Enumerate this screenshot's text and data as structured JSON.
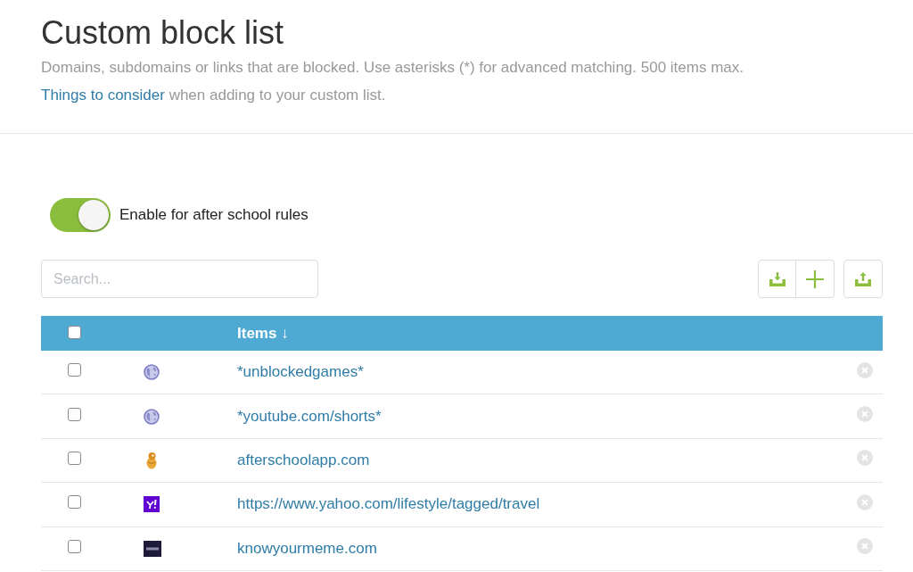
{
  "header": {
    "title": "Custom block list",
    "description": "Domains, subdomains or links that are blocked. Use asterisks (*) for advanced matching. 500 items max.",
    "note": {
      "link": "Things to consider",
      "text": "when adding to your custom list."
    }
  },
  "toggle": {
    "label": "Enable for after school rules",
    "on": true
  },
  "search": {
    "placeholder": "Search..."
  },
  "table": {
    "select_all": {
      "checked": false
    },
    "column_header": "Items ↓",
    "rows": [
      {
        "kind": "globe",
        "label": "*unblockedgames*",
        "checked": false
      },
      {
        "kind": "globe",
        "label": "*youtube.com/shorts*",
        "checked": false
      },
      {
        "kind": "mascot",
        "label": "afterschoolapp.com",
        "checked": false
      },
      {
        "kind": "mark-tile",
        "label": "https://www.yahoo.com/lifestyle/tagged/travel",
        "checked": false
      },
      {
        "kind": "dark-tile",
        "label": "knowyourmeme.com",
        "checked": false
      }
    ]
  }
}
